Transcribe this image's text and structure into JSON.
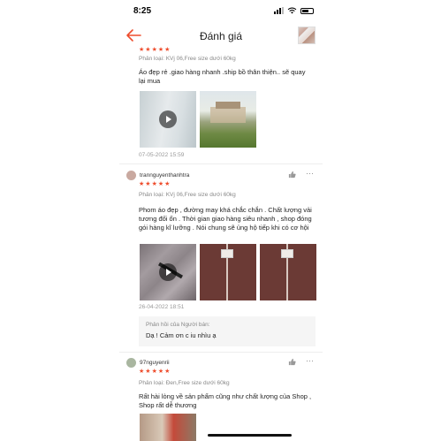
{
  "status_bar": {
    "time": "8:25"
  },
  "header": {
    "title": "Đánh giá"
  },
  "colors": {
    "accent": "#ee4d2d",
    "star": "#ee4d2d"
  },
  "icons": {
    "back": "arrow-left-icon",
    "like": "thumbs-up-icon",
    "more": "ellipsis-icon",
    "play": "play-icon"
  },
  "reviews": [
    {
      "username": "",
      "rating": 5,
      "variant": "Phân loại: KVj 06,Free size dưới 60kg",
      "comment": "Áo đẹp rẻ .giao hàng nhanh .ship bồ thân thiện.. sẽ quay lại mua",
      "date": "07-05-2022 15:59",
      "media_count": 2
    },
    {
      "username": "trannguyenthanhtra",
      "rating": 5,
      "variant": "Phân loại: KVj 06,Free size dưới 60kg",
      "comment": "Phom áo đẹp , đường may khá chắc chắn . Chất lượng vải tương đối ổn . Thời gian giao hàng siêu nhanh , shop đóng gói hàng kĩ lưỡng . Nói chung sẽ ủng hộ tiếp khi có cơ hội",
      "date": "26-04-2022 18:51",
      "media_count": 3,
      "seller_reply": {
        "label": "Phản hồi của Người bán:",
        "text": "Dạ ! Cảm ơn c iu nhìu ạ"
      }
    },
    {
      "username": "97nguyenrii",
      "rating": 5,
      "variant": "Phân loại: Đen,Free size dưới 60kg",
      "comment": "Rất hài lòng về sản phẩm cũng như chất lượng của Shop , Shop rất dễ thương"
    }
  ]
}
